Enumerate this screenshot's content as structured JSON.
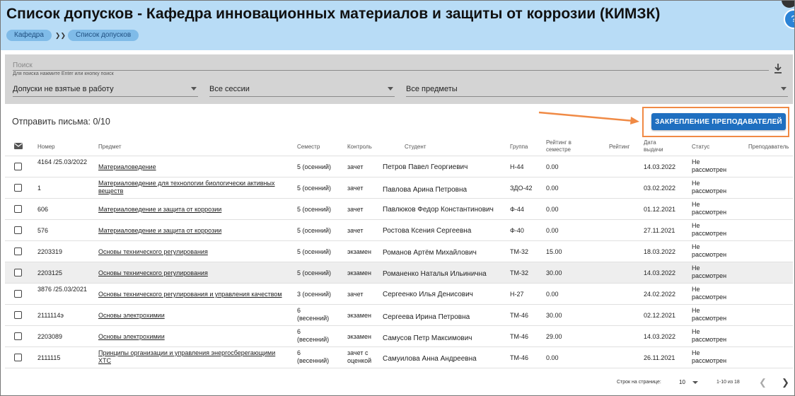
{
  "header": {
    "title": "Список допусков - Кафедра инновационных материалов и защиты от коррозии (КИМЗК)",
    "breadcrumb": [
      "Кафедра",
      "Список допусков"
    ],
    "help_icon": "help-icon",
    "colors": {
      "header_bg": "#b8dcf6",
      "crumb_bg": "#7fbbe8",
      "accent": "#1f6fc0"
    }
  },
  "filters": {
    "search_placeholder": "Поиск",
    "search_hint": "Для поиска нажмите Enter или кнопку поиск",
    "status_select": "Допуски не взятые в работу",
    "session_select": "Все сессии",
    "subject_select": "Все предметы"
  },
  "actions": {
    "send_letters": "Отправить письма: 0/10",
    "assign_button": "ЗАКРЕПЛЕНИЕ ПРЕПОДАВАТЕЛЕЙ"
  },
  "table": {
    "headers": {
      "number": "Номер",
      "subject": "Предмет",
      "semester": "Семестр",
      "control": "Контроль",
      "student": "Студент",
      "group": "Группа",
      "rating_sem": "Рейтинг в семестре",
      "rating": "Рейтинг",
      "issue_date": "Дата выдачи",
      "status": "Статус",
      "teacher": "Преподаватель"
    },
    "rows": [
      {
        "number": "4164 /25.03/2022",
        "subject": "Материаловедение",
        "semester": "5 (осенний)",
        "control": "зачет",
        "student": "Петров Павел Георгиевич",
        "group": "Н-44",
        "rating_sem": "0.00",
        "date": "14.03.2022",
        "status": "Не рассмотрен"
      },
      {
        "number": "1",
        "subject": "Материаловедение для технологии биологически активных веществ",
        "semester": "5 (осенний)",
        "control": "зачет",
        "student": "Павлова Арина Петровна",
        "group": "ЗДО-42",
        "rating_sem": "0.00",
        "date": "03.02.2022",
        "status": "Не рассмотрен"
      },
      {
        "number": "606",
        "subject": "Материаловедение и защита от коррозии",
        "semester": "5 (осенний)",
        "control": "зачет",
        "student": "Павлюков Федор Константинович",
        "group": "Ф-44",
        "rating_sem": "0.00",
        "date": "01.12.2021",
        "status": "Не рассмотрен"
      },
      {
        "number": "576",
        "subject": "Материаловедение и защита от коррозии",
        "semester": "5 (осенний)",
        "control": "зачет",
        "student": "Ростова Ксения Сергеевна",
        "group": "Ф-40",
        "rating_sem": "0.00",
        "date": "27.11.2021",
        "status": "Не рассмотрен"
      },
      {
        "number": "2203319",
        "subject": "Основы технического регулирования",
        "semester": "5 (осенний)",
        "control": "экзамен",
        "student": "Романов Артём Михайлович",
        "group": "ТМ-32",
        "rating_sem": "15.00",
        "date": "18.03.2022",
        "status": "Не рассмотрен"
      },
      {
        "number": "2203125",
        "subject": "Основы технического регулирования",
        "semester": "5 (осенний)",
        "control": "экзамен",
        "student": "Романенко Наталья Ильинична",
        "group": "ТМ-32",
        "rating_sem": "30.00",
        "date": "14.03.2022",
        "status": "Не рассмотрен"
      },
      {
        "number": "3876 /25.03/2021",
        "subject": "Основы технического регулирования и управления качеством",
        "semester": "3 (осенний)",
        "control": "зачет",
        "student": "Сергеенко Илья Денисович",
        "group": "Н-27",
        "rating_sem": "0.00",
        "date": "24.02.2022",
        "status": "Не рассмотрен"
      },
      {
        "number": "2111114э",
        "subject": "Основы электрохимии",
        "semester": "6 (весенний)",
        "control": "экзамен",
        "student": "Сергеева Ирина Петровна",
        "group": "ТМ-46",
        "rating_sem": "30.00",
        "date": "02.12.2021",
        "status": "Не рассмотрен"
      },
      {
        "number": "2203089",
        "subject": "Основы электрохимии",
        "semester": "6 (весенний)",
        "control": "экзамен",
        "student": "Самусов Петр Максимович",
        "group": "ТМ-46",
        "rating_sem": "29.00",
        "date": "14.03.2022",
        "status": "Не рассмотрен"
      },
      {
        "number": "2111115",
        "subject": "Принципы организации и управления энергосберегающими ХТС",
        "semester": "6 (весенний)",
        "control": "зачет с оценкой",
        "student": "Самуилова Анна Андреевна",
        "group": "ТМ-46",
        "rating_sem": "0.00",
        "date": "26.11.2021",
        "status": "Не рассмотрен"
      }
    ]
  },
  "pagination": {
    "rows_per_page_label": "Строк на странице:",
    "rows_per_page": "10",
    "range": "1-10 из 18"
  }
}
